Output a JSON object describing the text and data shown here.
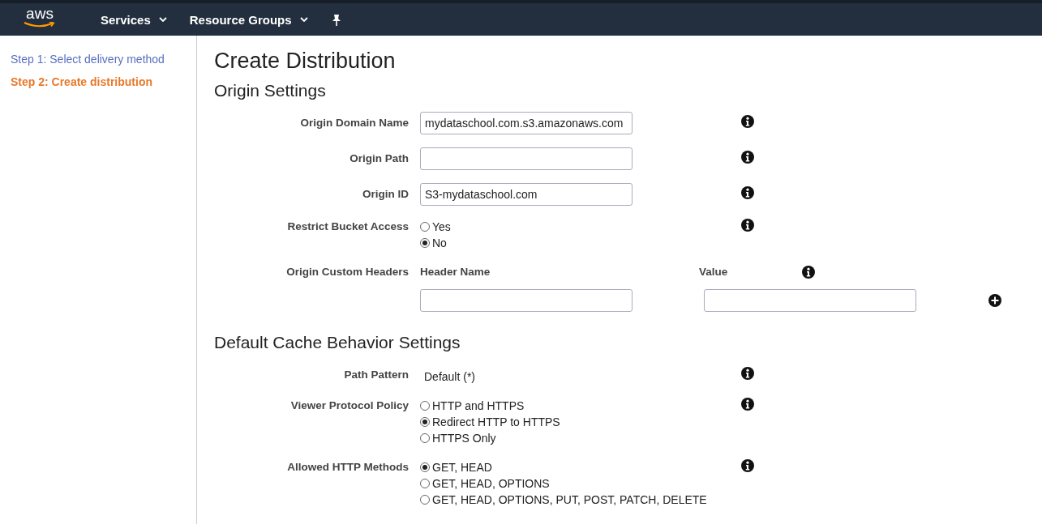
{
  "nav": {
    "logo": "aws",
    "menus": [
      {
        "label": "Services"
      },
      {
        "label": "Resource Groups"
      }
    ]
  },
  "sidebar": {
    "steps": [
      {
        "label": "Step 1: Select delivery method",
        "selected": false
      },
      {
        "label": "Step 2: Create distribution",
        "selected": true
      }
    ]
  },
  "page_title": "Create Distribution",
  "sections": [
    {
      "title": "Origin Settings",
      "fields": [
        {
          "kind": "text",
          "label": "Origin Domain Name",
          "value": "mydataschool.com.s3.amazonaws.com"
        },
        {
          "kind": "text",
          "label": "Origin Path"
        },
        {
          "kind": "text",
          "label": "Origin ID",
          "value": "S3-mydataschool.com"
        },
        {
          "kind": "radio",
          "label": "Restrict Bucket Access",
          "options": [
            {
              "label": "Yes",
              "selected": false
            },
            {
              "label": "No",
              "selected": true
            }
          ]
        },
        {
          "kind": "headers",
          "label": "Origin Custom Headers",
          "columns": [
            "Header Name",
            "Value"
          ]
        }
      ]
    },
    {
      "title": "Default Cache Behavior Settings",
      "fields": [
        {
          "kind": "static",
          "label": "Path Pattern",
          "value": "Default (*)"
        },
        {
          "kind": "radio",
          "label": "Viewer Protocol Policy",
          "options": [
            {
              "label": "HTTP and HTTPS",
              "selected": false
            },
            {
              "label": "Redirect HTTP to HTTPS",
              "selected": true
            },
            {
              "label": "HTTPS Only",
              "selected": false
            }
          ]
        },
        {
          "kind": "radio",
          "label": "Allowed HTTP Methods",
          "options": [
            {
              "label": "GET, HEAD",
              "selected": true
            },
            {
              "label": "GET, HEAD, OPTIONS",
              "selected": false
            },
            {
              "label": "GET, HEAD, OPTIONS, PUT, POST, PATCH, DELETE",
              "selected": false
            }
          ]
        }
      ]
    }
  ]
}
